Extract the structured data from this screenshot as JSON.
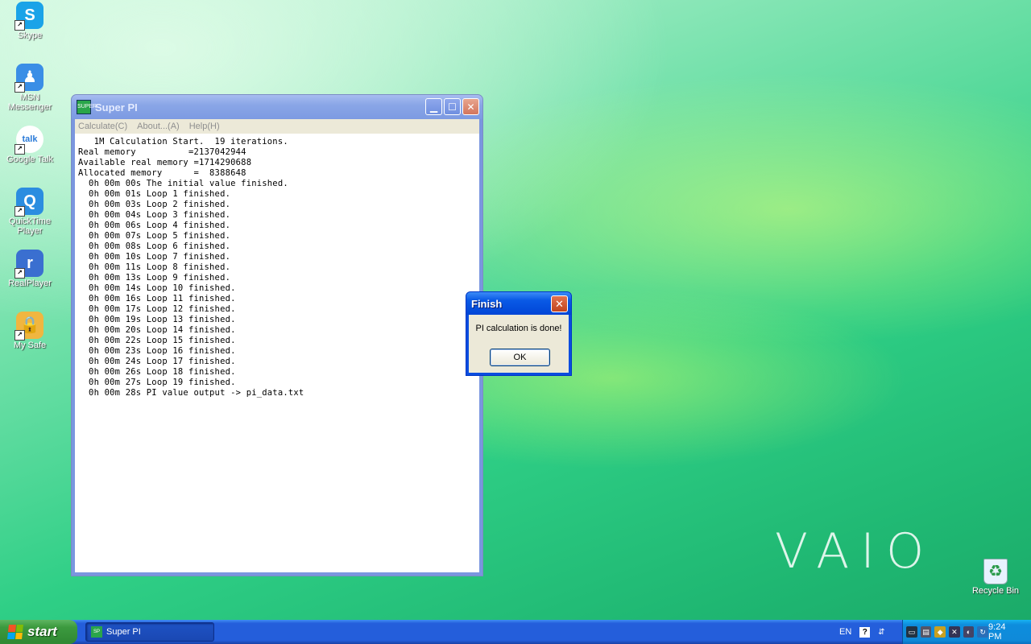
{
  "desktop": {
    "icons": [
      {
        "label": "Skype",
        "icon": "skype-icon",
        "color": "#1aa3e8",
        "glyph": "S"
      },
      {
        "label": "MSN Messenger",
        "icon": "msn-messenger-icon",
        "color": "#3a8ee6",
        "glyph": "♟"
      },
      {
        "label": "Google Talk",
        "icon": "google-talk-icon",
        "color": "#ffffff",
        "glyph": "talk"
      },
      {
        "label": "QuickTime Player",
        "icon": "quicktime-icon",
        "color": "#2b8de0",
        "glyph": "Q"
      },
      {
        "label": "RealPlayer",
        "icon": "realplayer-icon",
        "color": "#3a6fd0",
        "glyph": "r"
      },
      {
        "label": "My Safe",
        "icon": "my-safe-icon",
        "color": "#f0b640",
        "glyph": "🔒"
      }
    ],
    "recycle_bin": {
      "label": "Recycle Bin",
      "icon": "recycle-bin-icon"
    },
    "brand_logo": "VAIO"
  },
  "window": {
    "title": "Super PI",
    "menu": [
      "Calculate(C)",
      "About...(A)",
      "Help(H)"
    ],
    "console_lines": [
      "   1M Calculation Start.  19 iterations.",
      "Real memory          =2137042944",
      "Available real memory =1714290688",
      "Allocated memory      =  8388648",
      "  0h 00m 00s The initial value finished.",
      "  0h 00m 01s Loop 1 finished.",
      "  0h 00m 03s Loop 2 finished.",
      "  0h 00m 04s Loop 3 finished.",
      "  0h 00m 06s Loop 4 finished.",
      "  0h 00m 07s Loop 5 finished.",
      "  0h 00m 08s Loop 6 finished.",
      "  0h 00m 10s Loop 7 finished.",
      "  0h 00m 11s Loop 8 finished.",
      "  0h 00m 13s Loop 9 finished.",
      "  0h 00m 14s Loop 10 finished.",
      "  0h 00m 16s Loop 11 finished.",
      "  0h 00m 17s Loop 12 finished.",
      "  0h 00m 19s Loop 13 finished.",
      "  0h 00m 20s Loop 14 finished.",
      "  0h 00m 22s Loop 15 finished.",
      "  0h 00m 23s Loop 16 finished.",
      "  0h 00m 24s Loop 17 finished.",
      "  0h 00m 26s Loop 18 finished.",
      "  0h 00m 27s Loop 19 finished.",
      "  0h 00m 28s PI value output -> pi_data.txt"
    ]
  },
  "dialog": {
    "title": "Finish",
    "message": "PI calculation is done!",
    "ok_label": "OK"
  },
  "taskbar": {
    "start_label": "start",
    "task_label": "Super PI",
    "language": "EN",
    "help_glyph": "?",
    "clock": "9:24 PM"
  }
}
